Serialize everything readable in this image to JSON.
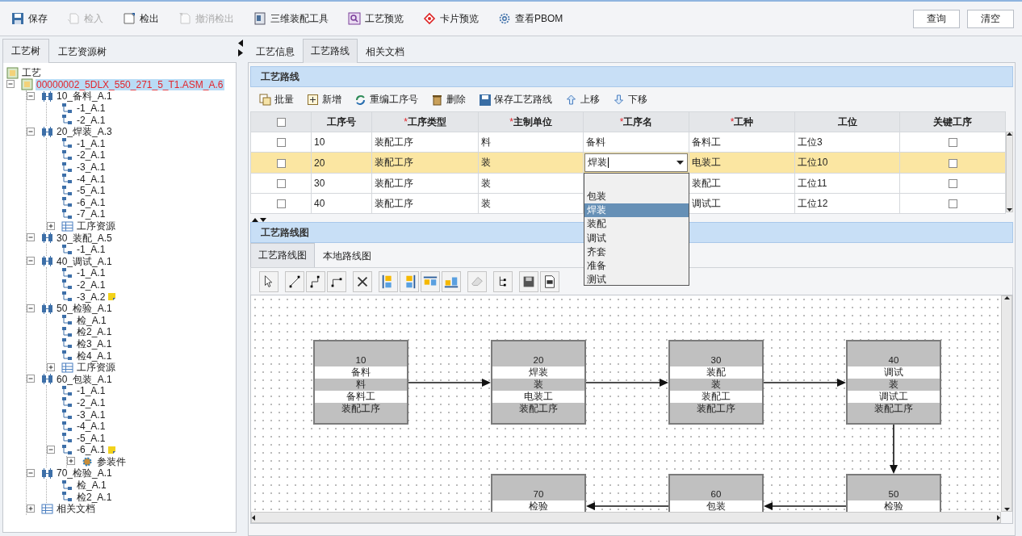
{
  "toolbar": {
    "buttons": [
      {
        "label": "保存",
        "disabled": false
      },
      {
        "label": "检入",
        "disabled": true
      },
      {
        "label": "检出",
        "disabled": false
      },
      {
        "label": "撤消检出",
        "disabled": true
      },
      {
        "label": "三维装配工具",
        "disabled": false
      },
      {
        "label": "工艺预览",
        "disabled": false
      },
      {
        "label": "卡片预览",
        "disabled": false
      },
      {
        "label": "查看PBOM",
        "disabled": false
      }
    ],
    "right_buttons": [
      "查询",
      "清空"
    ]
  },
  "left_panel": {
    "tabs": [
      {
        "label": "工艺树",
        "selected": true
      },
      {
        "label": "工艺资源树",
        "selected": false
      }
    ],
    "tree": [
      {
        "label": "工艺",
        "kind": "root",
        "selected": false,
        "children": [
          {
            "label": "00000002_5DLX_550_271_5_T1.ASM_A.6",
            "kind": "root",
            "selected": true,
            "expanded": true,
            "children": [
              {
                "label": "10_备料_A.1",
                "kind": "operation",
                "expanded": true,
                "children": [
                  {
                    "label": "-1_A.1",
                    "kind": "step"
                  },
                  {
                    "label": "-2_A.1",
                    "kind": "step"
                  }
                ]
              },
              {
                "label": "20_焊装_A.3",
                "kind": "operation",
                "expanded": true,
                "children": [
                  {
                    "label": "-1_A.1",
                    "kind": "step"
                  },
                  {
                    "label": "-2_A.1",
                    "kind": "step"
                  },
                  {
                    "label": "-3_A.1",
                    "kind": "step"
                  },
                  {
                    "label": "-4_A.1",
                    "kind": "step"
                  },
                  {
                    "label": "-5_A.1",
                    "kind": "step"
                  },
                  {
                    "label": "-6_A.1",
                    "kind": "step"
                  },
                  {
                    "label": "-7_A.1",
                    "kind": "step"
                  },
                  {
                    "label": "工序资源",
                    "kind": "resource",
                    "expanded": false
                  }
                ]
              },
              {
                "label": "30_装配_A.5",
                "kind": "operation",
                "expanded": true,
                "children": [
                  {
                    "label": "-1_A.1",
                    "kind": "step"
                  }
                ]
              },
              {
                "label": "40_调试_A.1",
                "kind": "operation",
                "expanded": true,
                "children": [
                  {
                    "label": "-1_A.1",
                    "kind": "step"
                  },
                  {
                    "label": "-2_A.1",
                    "kind": "step"
                  },
                  {
                    "label": "-3_A.2",
                    "kind": "step",
                    "note": true
                  }
                ]
              },
              {
                "label": "50_检验_A.1",
                "kind": "operation",
                "expanded": true,
                "children": [
                  {
                    "label": "检_A.1",
                    "kind": "step"
                  },
                  {
                    "label": "检2_A.1",
                    "kind": "step"
                  },
                  {
                    "label": "检3_A.1",
                    "kind": "step"
                  },
                  {
                    "label": "检4_A.1",
                    "kind": "step"
                  },
                  {
                    "label": "工序资源",
                    "kind": "resource",
                    "expanded": false
                  }
                ]
              },
              {
                "label": "60_包装_A.1",
                "kind": "operation",
                "expanded": true,
                "children": [
                  {
                    "label": "-1_A.1",
                    "kind": "step"
                  },
                  {
                    "label": "-2_A.1",
                    "kind": "step"
                  },
                  {
                    "label": "-3_A.1",
                    "kind": "step"
                  },
                  {
                    "label": "-4_A.1",
                    "kind": "step"
                  },
                  {
                    "label": "-5_A.1",
                    "kind": "step"
                  },
                  {
                    "label": "-6_A.1",
                    "kind": "step",
                    "note": true,
                    "expanded": true,
                    "children": [
                      {
                        "label": "参装件",
                        "kind": "parts",
                        "expanded": false
                      }
                    ]
                  }
                ]
              },
              {
                "label": "70_检验_A.1",
                "kind": "operation",
                "expanded": true,
                "children": [
                  {
                    "label": "检_A.1",
                    "kind": "step"
                  },
                  {
                    "label": "检2_A.1",
                    "kind": "step"
                  }
                ]
              },
              {
                "label": "相关文档",
                "kind": "resource",
                "expanded": false
              }
            ]
          }
        ]
      }
    ]
  },
  "right_tabs": [
    {
      "label": "工艺信息",
      "selected": false
    },
    {
      "label": "工艺路线",
      "selected": true
    },
    {
      "label": "相关文档",
      "selected": false
    }
  ],
  "route": {
    "title": "工艺路线",
    "actions": [
      "批量",
      "新增",
      "重编工序号",
      "删除",
      "保存工艺路线",
      "上移",
      "下移"
    ],
    "table": {
      "all_checked": false,
      "columns": [
        {
          "kind": "check"
        },
        {
          "kind": "text",
          "label": "工序号"
        },
        {
          "kind": "text",
          "mark": "*",
          "label": "工序类型"
        },
        {
          "kind": "text",
          "mark": "*",
          "label": "主制单位"
        },
        {
          "kind": "combo",
          "mark": "*",
          "label": "工序名"
        },
        {
          "kind": "text",
          "mark": "*",
          "label": "工种"
        },
        {
          "kind": "text",
          "label": "工位"
        },
        {
          "kind": "key",
          "label": "关键工序"
        }
      ],
      "rows": [
        {
          "selected": false,
          "checked": false,
          "editing": false,
          "cells": [
            "",
            "10",
            "装配工序",
            "料",
            "备料",
            "备料工",
            "工位3",
            ""
          ],
          "key_process": false
        },
        {
          "selected": true,
          "checked": false,
          "editing": true,
          "cells": [
            "",
            "20",
            "装配工序",
            "装",
            "焊装",
            "电装工",
            "工位10",
            ""
          ],
          "key_process": false
        },
        {
          "selected": false,
          "checked": false,
          "editing": false,
          "cells": [
            "",
            "30",
            "装配工序",
            "装",
            "",
            "装配工",
            "工位11",
            ""
          ],
          "key_process": false
        },
        {
          "selected": false,
          "checked": false,
          "editing": false,
          "cells": [
            "",
            "40",
            "装配工序",
            "装",
            "",
            "调试工",
            "工位12",
            ""
          ],
          "key_process": false
        }
      ],
      "dropdown": {
        "open": true,
        "options": [
          {
            "label": "包装",
            "selected": false
          },
          {
            "label": "焊装",
            "selected": true
          },
          {
            "label": "装配",
            "selected": false
          },
          {
            "label": "调试",
            "selected": false
          },
          {
            "label": "齐套",
            "selected": false
          },
          {
            "label": "准备",
            "selected": false
          },
          {
            "label": "测试",
            "selected": false
          }
        ]
      }
    }
  },
  "diagram": {
    "title": "工艺路线图",
    "tabs": [
      {
        "label": "工艺路线图",
        "selected": true
      },
      {
        "label": "本地路线图",
        "selected": false
      }
    ],
    "nodes": [
      {
        "lines": [
          "10",
          "备料",
          "料",
          "备料工",
          "装配工序"
        ]
      },
      {
        "lines": [
          "20",
          "焊装",
          "装",
          "电装工",
          "装配工序"
        ]
      },
      {
        "lines": [
          "30",
          "装配",
          "装",
          "装配工",
          "装配工序"
        ]
      },
      {
        "lines": [
          "40",
          "调试",
          "装",
          "调试工",
          "装配工序"
        ]
      },
      {
        "lines": [
          "70",
          "检验"
        ]
      },
      {
        "lines": [
          "60",
          "包装"
        ]
      },
      {
        "lines": [
          "50",
          "检验"
        ]
      }
    ]
  }
}
